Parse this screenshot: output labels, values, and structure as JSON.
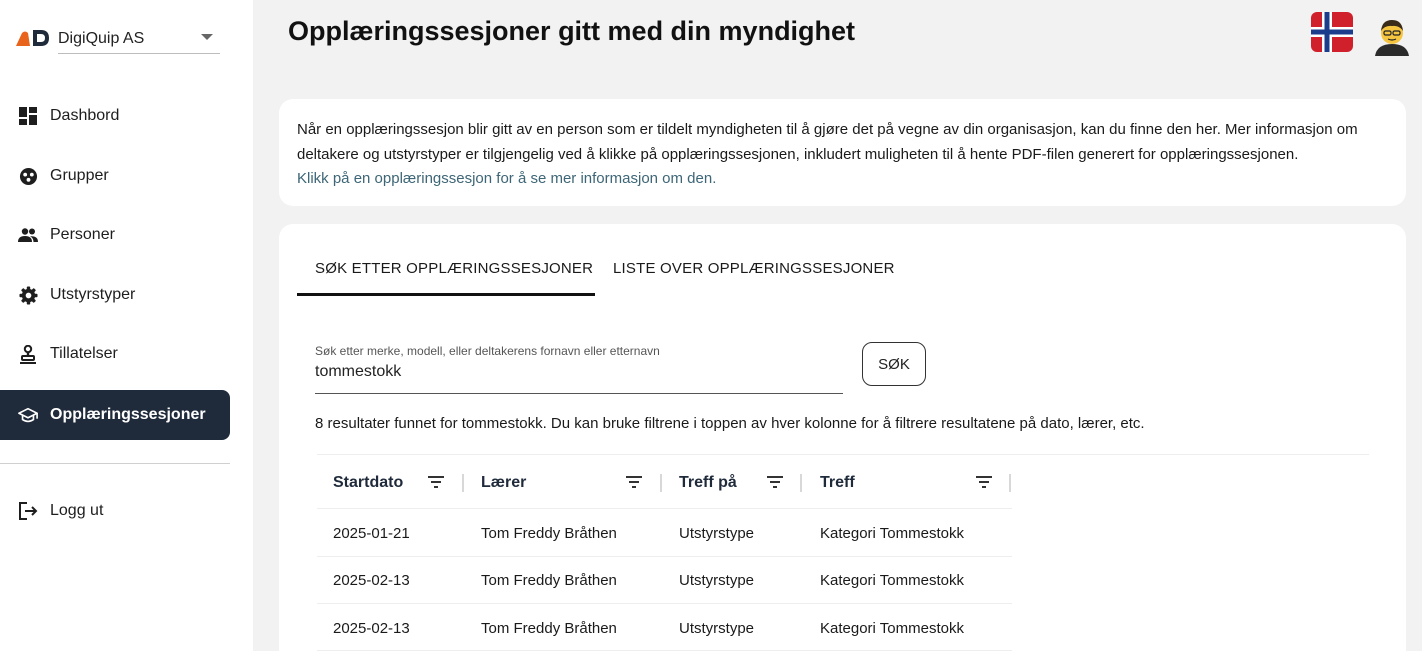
{
  "sidebar": {
    "org_name": "DigiQuip AS",
    "items": [
      {
        "label": "Dashbord",
        "icon": "dashboard-icon"
      },
      {
        "label": "Grupper",
        "icon": "groups-icon"
      },
      {
        "label": "Personer",
        "icon": "people-icon"
      },
      {
        "label": "Utstyrstyper",
        "icon": "gear-icon"
      },
      {
        "label": "Tillatelser",
        "icon": "permission-icon"
      },
      {
        "label": "Opplæringssesjoner",
        "icon": "school-icon",
        "active": true
      }
    ],
    "logout_label": "Logg ut"
  },
  "header": {
    "title": "Opplæringssesjoner gitt med din myndighet"
  },
  "info": {
    "text": "Når en opplæringssesjon blir gitt av en person som er tildelt myndigheten til å gjøre det på vegne av din organisasjon, kan du finne den her. Mer informasjon om deltakere og utstyrstyper er tilgjengelig ved å klikke på opplæringssesjonen, inkludert muligheten til å hente PDF-filen generert for opplæringssesjonen.",
    "hint": "Klikk på en opplæringssesjon for å se mer informasjon om den."
  },
  "tabs": [
    {
      "label": "SØK ETTER OPPLÆRINGSSESJONER",
      "active": true
    },
    {
      "label": "LISTE OVER OPPLÆRINGSSESJONER",
      "active": false
    }
  ],
  "search": {
    "label": "Søk etter merke, modell, eller deltakerens fornavn eller etternavn",
    "value": "tommestokk",
    "button_label": "SØK"
  },
  "results_text": "8 resultater funnet for tommestokk. Du kan bruke filtrene i toppen av hver kolonne for å filtrere resultatene på dato, lærer, etc.",
  "table": {
    "columns": [
      "Startdato",
      "Lærer",
      "Treff på",
      "Treff"
    ],
    "rows": [
      [
        "2025-01-21",
        "Tom Freddy Bråthen",
        "Utstyrstype",
        "Kategori Tommestokk"
      ],
      [
        "2025-02-13",
        "Tom Freddy Bråthen",
        "Utstyrstype",
        "Kategori Tommestokk"
      ],
      [
        "2025-02-13",
        "Tom Freddy Bråthen",
        "Utstyrstype",
        "Kategori Tommestokk"
      ]
    ]
  },
  "colors": {
    "sidebar_active_bg": "#1f2a3a",
    "logo_orange": "#e8641c",
    "link": "#3d6676",
    "flag_red": "#d0202c",
    "flag_blue": "#1c3d8c"
  }
}
